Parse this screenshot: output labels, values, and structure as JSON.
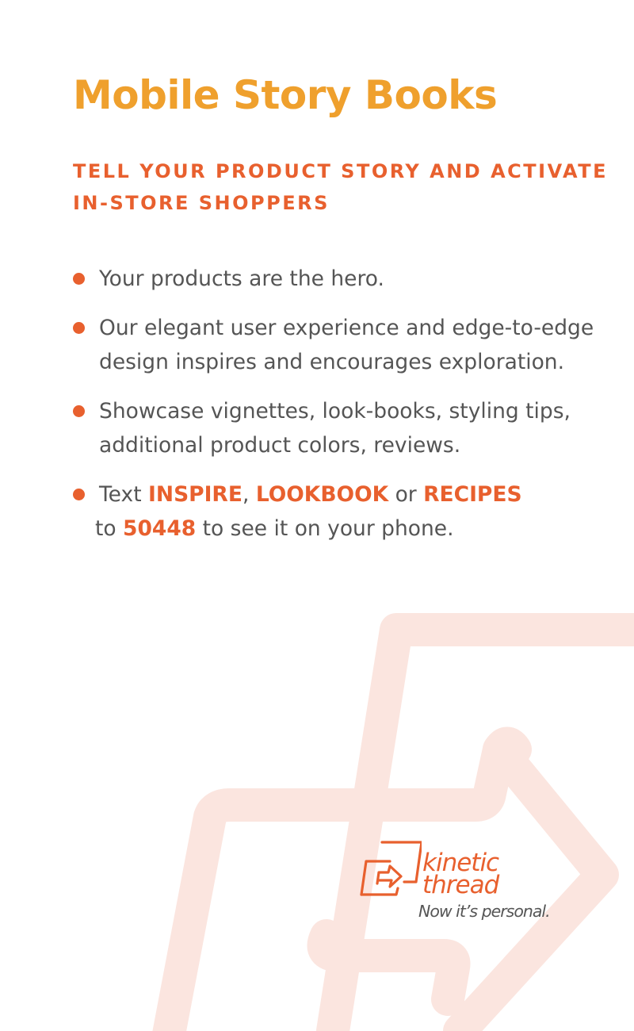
{
  "title": "Mobile Story Books",
  "subtitle": "TELL YOUR PRODUCT STORY AND ACTIVATE IN-STORE SHOPPERS",
  "bullets": [
    {
      "text": "Your products are the hero."
    },
    {
      "text": "Our elegant user experience and edge-to-edge design inspires and encourages exploration."
    },
    {
      "text": "Showcase vignettes, look-books, styling tips, additional product colors, reviews."
    },
    {
      "text_prefix": "Text ",
      "keyword_1": "INSPIRE",
      "sep_1": ", ",
      "keyword_2": "LOOKBOOK",
      "sep_2": " or ",
      "keyword_3": "RECIPES",
      "sep_3": " to ",
      "number": "50448",
      "text_suffix": " to see it on your phone."
    }
  ],
  "logo": {
    "word_1": "kinetic",
    "word_2": "thread",
    "tagline": "Now it’s personal."
  },
  "colors": {
    "title": "#EFA02D",
    "accent": "#E8602E",
    "body_text": "#555555",
    "background_art": "#FBE5DF"
  },
  "icons": {
    "bullet": "bullet-dot",
    "logo_mark": "arrow-box-logo",
    "background": "large-arrow-outline"
  }
}
